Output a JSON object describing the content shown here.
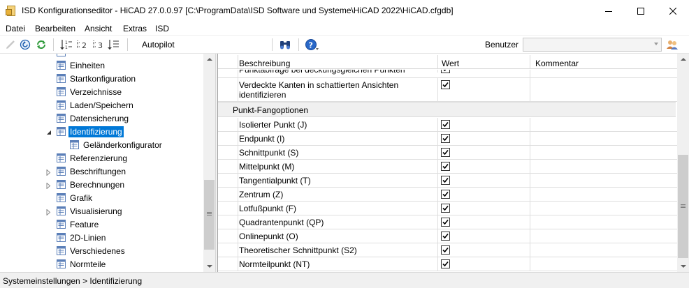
{
  "window": {
    "title": "ISD Konfigurationseditor - HiCAD 27.0.0.97 [C:\\ProgramData\\ISD Software und Systeme\\HiCAD 2022\\HiCAD.cfgdb]"
  },
  "menu": [
    "Datei",
    "Bearbeiten",
    "Ansicht",
    "Extras",
    "ISD"
  ],
  "toolbar": {
    "autopilot_label": "Autopilot",
    "benutzer_label": "Benutzer",
    "benutzer_value": ""
  },
  "tree": {
    "items": [
      {
        "label": "Einheiten",
        "selected": false
      },
      {
        "label": "Startkonfiguration",
        "selected": false
      },
      {
        "label": "Verzeichnisse",
        "selected": false
      },
      {
        "label": "Laden/Speichern",
        "selected": false
      },
      {
        "label": "Datensicherung",
        "selected": false
      },
      {
        "label": "Identifizierung",
        "selected": true,
        "expanded": true
      },
      {
        "label": "Geländerkonfigurator",
        "selected": false,
        "child": true
      },
      {
        "label": "Referenzierung",
        "selected": false
      },
      {
        "label": "Beschriftungen",
        "selected": false,
        "collapsed": true
      },
      {
        "label": "Berechnungen",
        "selected": false,
        "collapsed": true
      },
      {
        "label": "Grafik",
        "selected": false
      },
      {
        "label": "Visualisierung",
        "selected": false,
        "collapsed": true
      },
      {
        "label": "Feature",
        "selected": false
      },
      {
        "label": "2D-Linien",
        "selected": false
      },
      {
        "label": "Verschiedenes",
        "selected": false
      },
      {
        "label": "Normteile",
        "selected": false
      }
    ]
  },
  "grid": {
    "columns": [
      "Beschreibung",
      "Wert",
      "Kommentar"
    ],
    "rows_top": [
      {
        "label": "Punktabfrage bei deckungsgleichen Punkten",
        "checked": true
      },
      {
        "label": "Verdeckte Kanten in schattierten Ansichten identifizieren",
        "checked": true
      }
    ],
    "group_label": "Punkt-Fangoptionen",
    "rows": [
      {
        "label": "Isolierter Punkt (J)",
        "checked": true
      },
      {
        "label": "Endpunkt (I)",
        "checked": true
      },
      {
        "label": "Schnittpunkt (S)",
        "checked": true
      },
      {
        "label": "Mittelpunkt (M)",
        "checked": true
      },
      {
        "label": "Tangentialpunkt (T)",
        "checked": true
      },
      {
        "label": "Zentrum (Z)",
        "checked": true
      },
      {
        "label": "Lotfußpunkt (F)",
        "checked": true
      },
      {
        "label": "Quadrantenpunkt (QP)",
        "checked": true
      },
      {
        "label": "Onlinepunkt (O)",
        "checked": true
      },
      {
        "label": "Theoretischer Schnittpunkt (S2)",
        "checked": true
      },
      {
        "label": "Normteilpunkt (NT)",
        "checked": true
      }
    ]
  },
  "status": {
    "text": "Systemeinstellungen > Identifizierung"
  },
  "colors": {
    "selection": "#0078d7",
    "group_bg": "#f0f0f0"
  }
}
